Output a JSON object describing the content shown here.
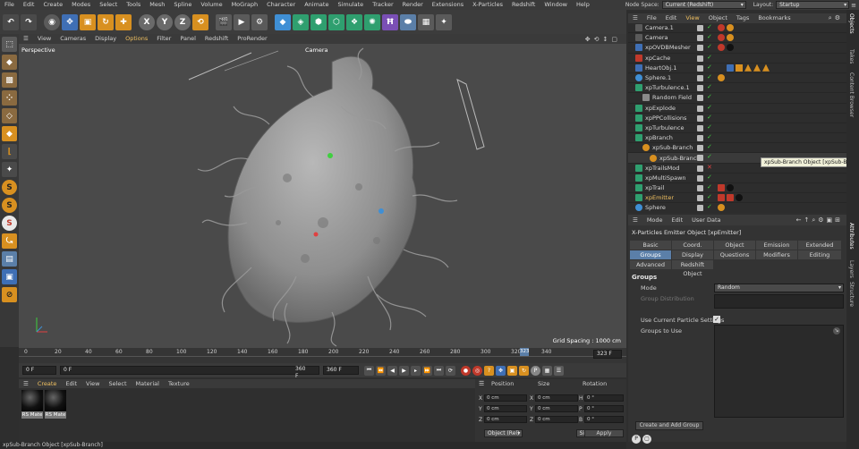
{
  "menubar": {
    "items": [
      "File",
      "Edit",
      "Create",
      "Modes",
      "Select",
      "Tools",
      "Mesh",
      "Spline",
      "Volume",
      "MoGraph",
      "Character",
      "Animate",
      "Simulate",
      "Tracker",
      "Render",
      "Extensions",
      "X-Particles",
      "Redshift",
      "Window",
      "Help"
    ],
    "node_space_label": "Node Space:",
    "node_space_value": "Current (Redshift)",
    "layout_label": "Layout:",
    "layout_value": "Startup"
  },
  "toolbar": {
    "axis_x": "X",
    "axis_y": "Y",
    "axis_z": "Z"
  },
  "viewport_menu": {
    "items": [
      "View",
      "Cameras",
      "Display",
      "Options",
      "Filter",
      "Panel",
      "Redshift",
      "ProRender"
    ]
  },
  "viewport": {
    "label": "Perspective",
    "camera_label": "Camera",
    "grid_spacing": "Grid Spacing : 1000 cm"
  },
  "timeline": {
    "ticks": [
      "0",
      "20",
      "40",
      "60",
      "80",
      "100",
      "120",
      "140",
      "160",
      "180",
      "200",
      "220",
      "240",
      "260",
      "280",
      "300",
      "320",
      "340"
    ],
    "current_marker": "323",
    "end_field": "323 F"
  },
  "playbar": {
    "start": "0 F",
    "current": "0 F",
    "end1": "360 F",
    "end2": "360 F"
  },
  "material_manager": {
    "menu": [
      "Create",
      "Edit",
      "View",
      "Select",
      "Material",
      "Texture"
    ],
    "materials": [
      {
        "name": "RS Mate"
      },
      {
        "name": "RS Mate"
      }
    ]
  },
  "coordinates": {
    "headers": [
      "Position",
      "Size",
      "Rotation"
    ],
    "rows": [
      {
        "axis": "X",
        "pos": "0 cm",
        "size": "0 cm",
        "rot_axis": "H",
        "rot": "0 °"
      },
      {
        "axis": "Y",
        "pos": "0 cm",
        "size": "0 cm",
        "rot_axis": "P",
        "rot": "0 °"
      },
      {
        "axis": "Z",
        "pos": "0 cm",
        "size": "0 cm",
        "rot_axis": "B",
        "rot": "0 °"
      }
    ],
    "mode": "Object (Rel)",
    "size_mode": "Size",
    "apply": "Apply"
  },
  "status_bar": "xpSub-Branch Object [xpSub-Branch]",
  "object_manager": {
    "menu": [
      "File",
      "Edit",
      "View",
      "Object",
      "Tags",
      "Bookmarks"
    ],
    "objects": [
      {
        "name": "Camera.1",
        "icon_color": "#5a5a5a"
      },
      {
        "name": "Camera",
        "icon_color": "#5a5a5a"
      },
      {
        "name": "xpOVDBMesher",
        "icon_color": "#3f6fb5"
      },
      {
        "name": "xpCache",
        "icon_color": "#c0392b"
      },
      {
        "name": "HeartObj.1",
        "icon_color": "#3f6fb5"
      },
      {
        "name": "Sphere.1",
        "icon_color": "#3f8fd5"
      },
      {
        "name": "xpTurbulence.1",
        "icon_color": "#2f9f6f"
      },
      {
        "name": "Random Field",
        "icon_color": "#8a8a8a"
      },
      {
        "name": "xpExplode",
        "icon_color": "#2f9f6f"
      },
      {
        "name": "xpPPCollisions",
        "icon_color": "#2f9f6f"
      },
      {
        "name": "xpTurbulence",
        "icon_color": "#2f9f6f"
      },
      {
        "name": "xpBranch",
        "icon_color": "#2f9f6f"
      },
      {
        "name": "xpSub-Branch",
        "icon_color": "#d89020"
      },
      {
        "name": "xpSub-Branch",
        "icon_color": "#d89020"
      },
      {
        "name": "xpTrailsMod",
        "icon_color": "#2f9f6f"
      },
      {
        "name": "xpMultiSpawn",
        "icon_color": "#2f9f6f"
      },
      {
        "name": "xpTrail",
        "icon_color": "#2f9f6f"
      },
      {
        "name": "xpEmitter",
        "icon_color": "#2f9f6f"
      },
      {
        "name": "Sphere",
        "icon_color": "#3f8fd5"
      }
    ],
    "tooltip": "xpSub-Branch Object [xpSub-Branch]"
  },
  "attributes": {
    "menu": [
      "Mode",
      "Edit",
      "User Data"
    ],
    "title": "X-Particles Emitter Object [xpEmitter]",
    "tabs": [
      {
        "label": "Basic",
        "active": false
      },
      {
        "label": "Coord.",
        "active": false
      },
      {
        "label": "Object",
        "active": false
      },
      {
        "label": "Emission",
        "active": false
      },
      {
        "label": "Extended Data",
        "active": false
      },
      {
        "label": "Groups",
        "active": true
      },
      {
        "label": "Display",
        "active": false
      },
      {
        "label": "Questions",
        "active": false
      },
      {
        "label": "Modifiers",
        "active": false
      },
      {
        "label": "Editing",
        "active": false
      },
      {
        "label": "Advanced",
        "active": false
      },
      {
        "label": "Redshift Object",
        "active": false
      }
    ],
    "section": "Groups",
    "mode_label": "Mode",
    "mode_value": "Random",
    "group_distribution_label": "Group Distribution",
    "use_current_label": "Use Current Particle Settings",
    "groups_to_use_label": "Groups to Use",
    "create_button": "Create and Add Group"
  },
  "side_tabs": [
    "Objects",
    "Takes",
    "Content Browser",
    "Attributes",
    "Layers",
    "Structure"
  ]
}
